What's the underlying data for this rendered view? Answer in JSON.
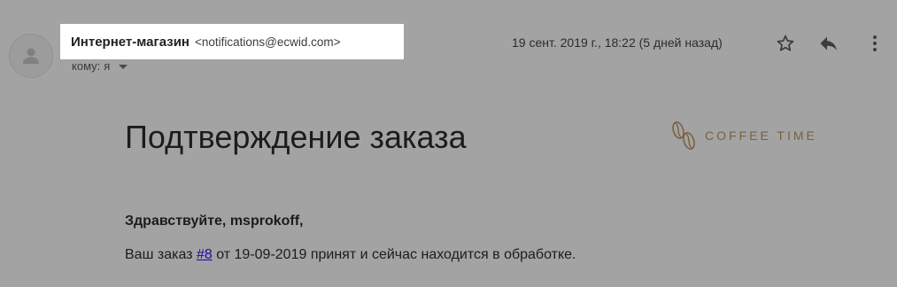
{
  "sender": {
    "name": "Интернет-магазин",
    "email": "<notifications@ecwid.com>"
  },
  "recipient": {
    "label": "кому:",
    "value": "я"
  },
  "date": "19 сент. 2019 г., 18:22 (5 дней назад)",
  "icons": {
    "avatar": "person-icon",
    "star": "star-icon",
    "reply": "reply-icon",
    "more": "more-vert-icon",
    "recipient_dropdown": "caret-down-icon",
    "logo": "coffee-beans-icon"
  },
  "email": {
    "heading": "Подтверждение заказа",
    "logo_text": "COFFEE TIME",
    "greeting": "Здравствуйте, msprokoff,",
    "order": {
      "prefix": "Ваш заказ",
      "link": "#8",
      "suffix": "от 19-09-2019 принят и сейчас находится в обработке."
    }
  },
  "colors": {
    "overlay_background": "#a3a3a3",
    "highlight_box": "#ffffff",
    "link": "#1a0dab",
    "logo": "#7a6040"
  }
}
